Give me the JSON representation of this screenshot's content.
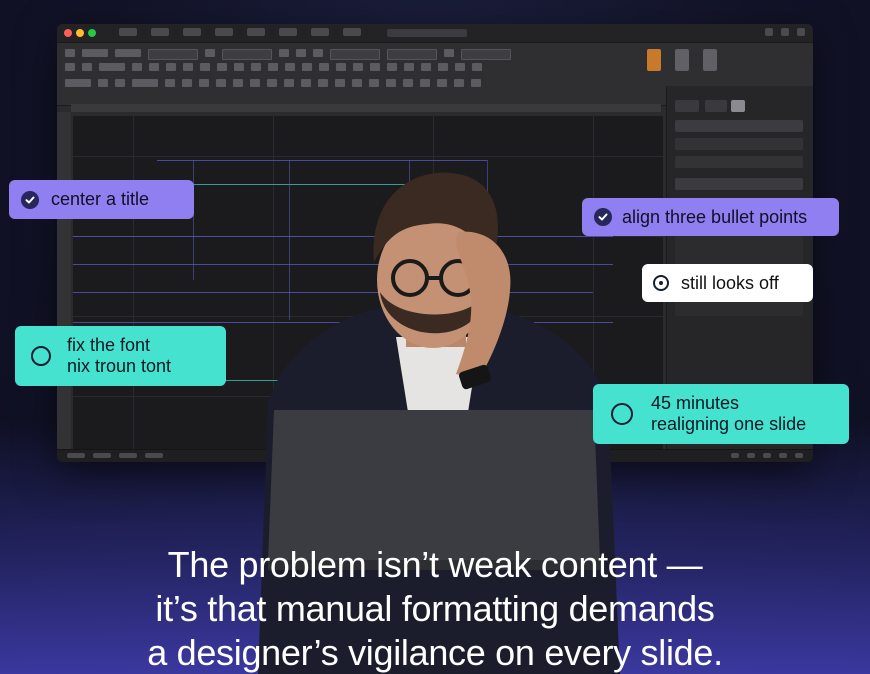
{
  "callouts": {
    "center_title": "center a title",
    "align_bullets": "align three bullet points",
    "still_off": "still looks off",
    "fix_font_line1": "fix the font",
    "fix_font_line2": "nix troun tont",
    "minutes_line1": "45 minutes",
    "minutes_line2": "realigning one slide"
  },
  "caption": {
    "line1": "The problem isn’t weak content —",
    "line2": "it’s that manual formatting demands",
    "line3": "a designer’s vigilance on every slide."
  },
  "icons": {
    "check": "check-circle-icon",
    "empty": "empty-circle-icon",
    "dotted": "radio-dot-icon"
  },
  "colors": {
    "purple_callout": "#8f7ff0",
    "teal_callout": "#45e3cf",
    "white_callout": "#ffffff",
    "guide_line": "#5a5acc",
    "teal_guide": "#3fc9c3"
  }
}
